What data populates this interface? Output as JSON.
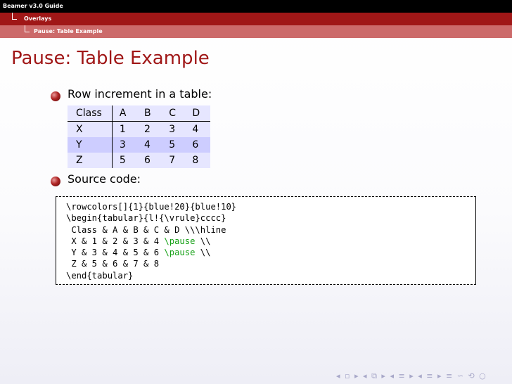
{
  "headline": {
    "title": "Beamer v3.0 Guide",
    "section": "Overlays",
    "subsection": "Pause: Table Example"
  },
  "frame_title": "Pause: Table Example",
  "bullets": [
    "Row increment in a table:",
    "Source code:"
  ],
  "table": {
    "header": [
      "Class",
      "A",
      "B",
      "C",
      "D"
    ],
    "rows": [
      [
        "X",
        "1",
        "2",
        "3",
        "4"
      ],
      [
        "Y",
        "3",
        "4",
        "5",
        "6"
      ],
      [
        "Z",
        "5",
        "6",
        "7",
        "8"
      ]
    ]
  },
  "code": {
    "lines": [
      "\\rowcolors[]{1}{blue!20}{blue!10}",
      "\\begin{tabular}{l!{\\vrule}cccc}",
      " Class & A & B & C & D \\\\\\hline",
      " X & 1 & 2 & 3 & 4 ",
      " Y & 3 & 4 & 5 & 6 ",
      " Z & 5 & 6 & 7 & 8",
      "\\end{tabular}"
    ],
    "pause_keyword": "\\pause",
    "line_end": " \\\\"
  },
  "navigation": {
    "icons": [
      "prev-slide-icon",
      "next-slide-icon",
      "prev-frame-icon",
      "next-frame-icon",
      "prev-subsection-icon",
      "next-subsection-icon",
      "prev-section-icon",
      "next-section-icon",
      "align-icon",
      "search-icon"
    ],
    "glyphs": [
      "◂",
      "▫",
      "▸",
      "◂",
      "⧉",
      "▸",
      "◂",
      "≡",
      "▸",
      "◂",
      "≡",
      "▸",
      "≡",
      "∽",
      "⟲",
      "○"
    ]
  },
  "colors": {
    "headline_black": "#000000",
    "headline_red": "#a01717",
    "headline_pink": "#cc6a6a",
    "title_red": "#a01717",
    "row_light": "#e6e6ff",
    "row_dark": "#cdcdff",
    "keyword_green": "#16a016"
  }
}
